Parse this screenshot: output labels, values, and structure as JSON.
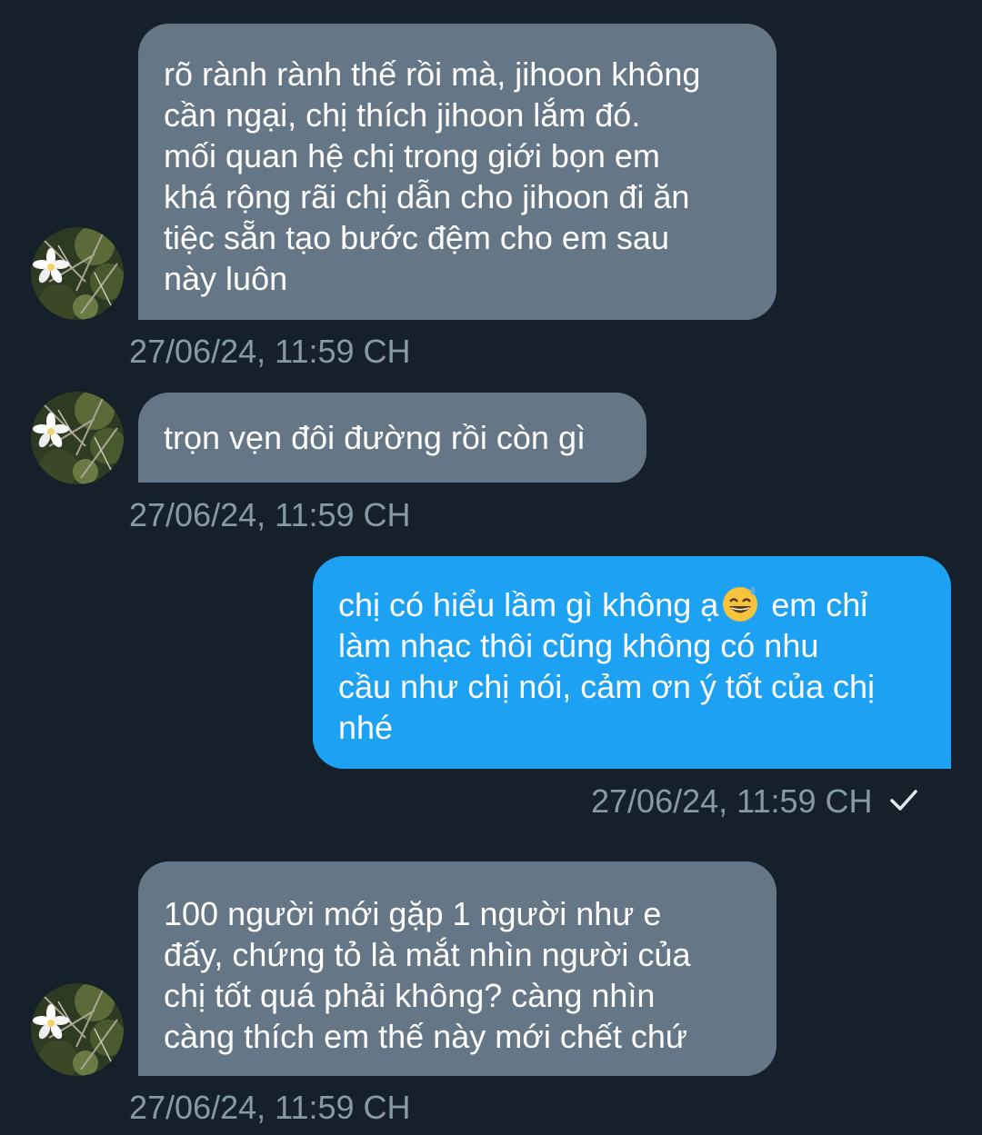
{
  "messages": [
    {
      "direction": "incoming",
      "text": "rõ rành rành thế rồi mà, jihoon không\ncần ngại, chị thích jihoon lắm đó.\nmối quan hệ chị trong giới bọn em\nkhá rộng rãi chị dẫn cho jihoon đi ăn\ntiệc sẵn tạo bước đệm cho em sau\nnày luôn",
      "timestamp": "27/06/24, 11:59 CH"
    },
    {
      "direction": "incoming",
      "text": "trọn vẹn đôi đường rồi còn gì",
      "timestamp": "27/06/24, 11:59 CH"
    },
    {
      "direction": "outgoing",
      "text_before_emoji": "chị có hiểu lầm gì không ạ",
      "emoji": "grinning-face-with-sweat-emoji",
      "text_after_emoji": " em chỉ\nlàm nhạc thôi cũng không có nhu\ncầu như chị nói, cảm ơn ý tốt của chị\nnhé",
      "timestamp": "27/06/24, 11:59 CH",
      "status": "sent-checkmark"
    },
    {
      "direction": "incoming",
      "text": "100 người mới gặp 1 người như e\nđấy, chứng tỏ là mắt nhìn người của\nchị tốt quá phải không? càng nhìn\ncàng thích em thế này mới chết chứ",
      "timestamp": "27/06/24, 11:59 CH"
    }
  ],
  "colors": {
    "background": "#15202b",
    "incoming_bubble": "#657786",
    "outgoing_bubble": "#1da1f2",
    "timestamp": "#8899a6"
  },
  "icons": {
    "avatar": "flower-avatar",
    "read_receipt": "check-icon"
  }
}
